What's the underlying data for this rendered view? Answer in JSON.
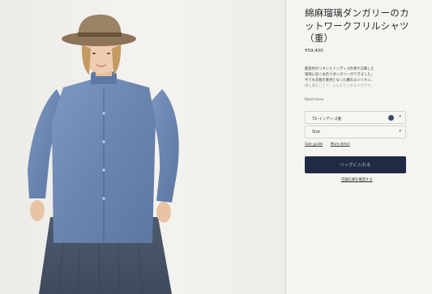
{
  "product": {
    "title": "綿麻瑠璃ダンガリーのカットワークフリルシャツ（重）",
    "price": "¥59,400",
    "description_lines": [
      "藍鉄色のリネンとインディゴの青が交織した",
      "瑠璃に良く似合うダンガリーができました。",
      "今でも衣服を素材となった麗のよいリネン。",
      "綿と麻のことで、ふんわりとゆるやかです。"
    ],
    "read_more": "Read more"
  },
  "options": {
    "color_value": "72-インディゴ重",
    "color_swatch": "#3a4a66",
    "size_value": "Size"
  },
  "links": {
    "size_guide": "Size guide",
    "more_detail": "More detail"
  },
  "actions": {
    "add_to_cart": "バッグに入れる",
    "check_store_stock": "店舗在庫を確認する"
  },
  "colors": {
    "accent": "#1f2a44",
    "background": "#f5f4f1"
  }
}
